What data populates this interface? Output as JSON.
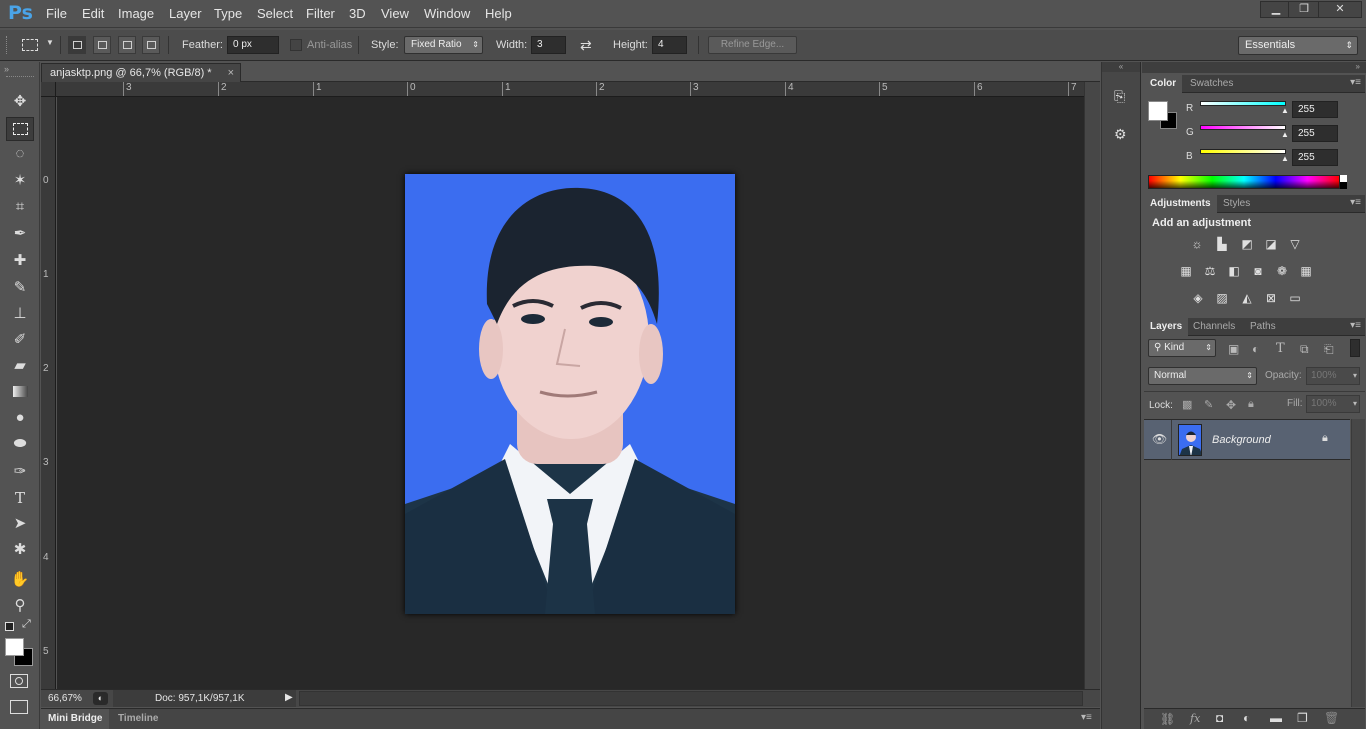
{
  "app": {
    "logo": "Ps"
  },
  "menu": [
    "File",
    "Edit",
    "Image",
    "Layer",
    "Type",
    "Select",
    "Filter",
    "3D",
    "View",
    "Window",
    "Help"
  ],
  "window_controls": {
    "minimize": "▁",
    "restore": "❐",
    "close": "✕"
  },
  "options": {
    "feather_label": "Feather:",
    "feather_value": "0 px",
    "antialias_label": "Anti-alias",
    "style_label": "Style:",
    "style_value": "Fixed Ratio",
    "width_label": "Width:",
    "width_value": "3",
    "height_label": "Height:",
    "height_value": "4",
    "refine_edge": "Refine Edge...",
    "workspace": "Essentials"
  },
  "document": {
    "tab_title": "anjasktp.png @ 66,7% (RGB/8) *",
    "close": "×",
    "ruler_top_labels": [
      "3",
      "2",
      "1",
      "0",
      "1",
      "2",
      "3",
      "4",
      "5",
      "6",
      "7"
    ],
    "ruler_left_labels": [
      "0",
      "1",
      "2",
      "3",
      "4",
      "5"
    ]
  },
  "status": {
    "zoom": "66,67%",
    "doc_info": "Doc: 957,1K/957,1K"
  },
  "bottom_tabs": {
    "mini_bridge": "Mini Bridge",
    "timeline": "Timeline"
  },
  "panels": {
    "color": {
      "tabs": [
        "Color",
        "Swatches"
      ],
      "channels": [
        {
          "label": "R",
          "value": "255",
          "color": "#00ffff"
        },
        {
          "label": "G",
          "value": "255",
          "color": "#ff00ff"
        },
        {
          "label": "B",
          "value": "255",
          "color": "#ffff00"
        }
      ]
    },
    "adjustments": {
      "tabs": [
        "Adjustments",
        "Styles"
      ],
      "title": "Add an adjustment"
    },
    "layers": {
      "tabs": [
        "Layers",
        "Channels",
        "Paths"
      ],
      "filter_kind": "Kind",
      "blend_mode": "Normal",
      "opacity_label": "Opacity:",
      "opacity_value": "100%",
      "lock_label": "Lock:",
      "fill_label": "Fill:",
      "fill_value": "100%",
      "layer_name": "Background"
    }
  },
  "colors": {
    "photo_background": "#3b6df0",
    "accent": "#4aa4e8"
  }
}
